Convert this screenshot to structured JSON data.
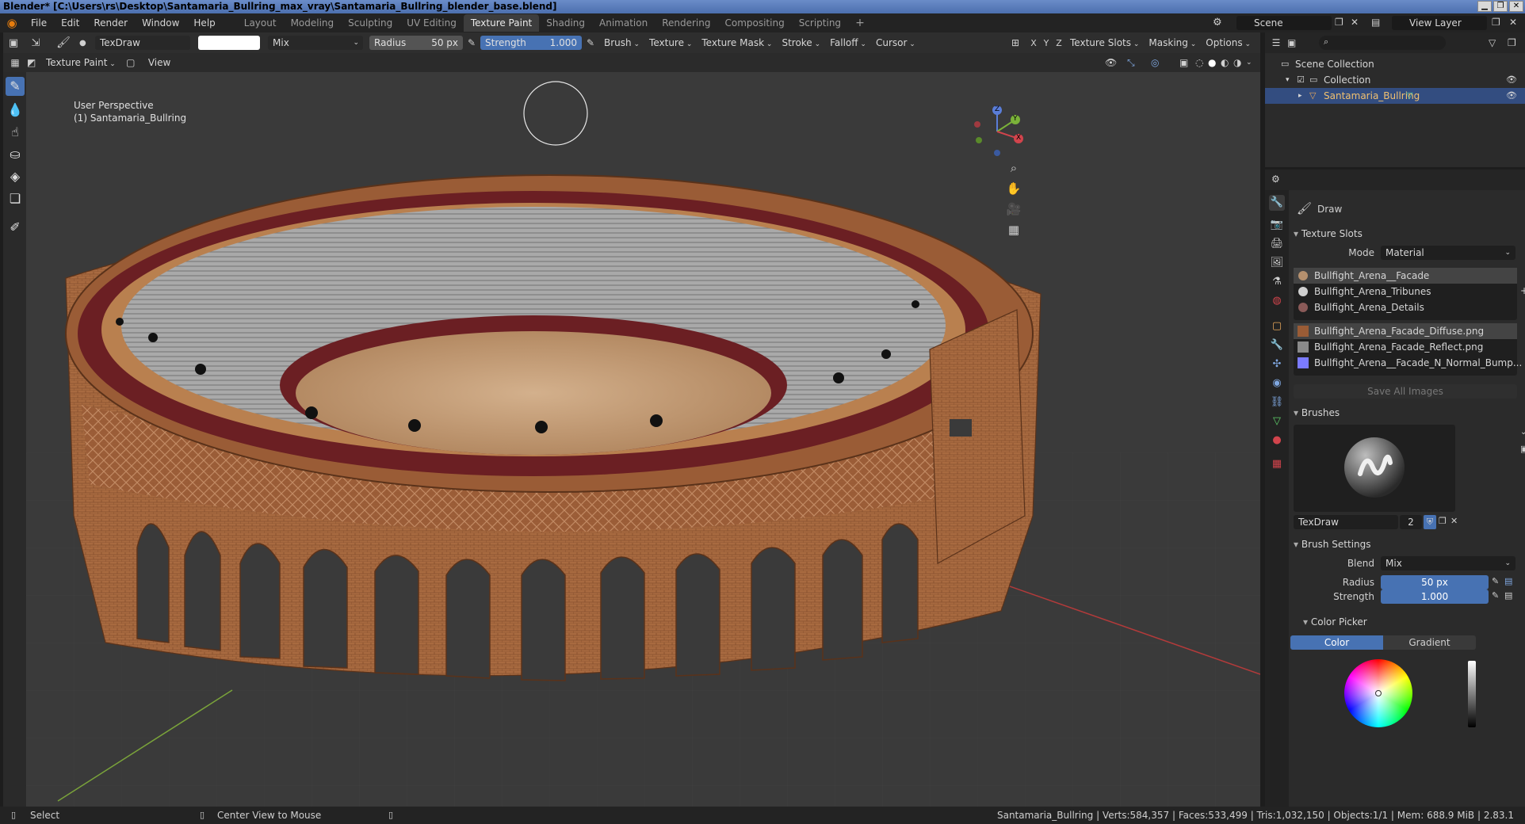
{
  "window": {
    "title": "Blender* [C:\\Users\\rs\\Desktop\\Santamaria_Bullring_max_vray\\Santamaria_Bullring_blender_base.blend]",
    "controls": [
      "▁",
      "❐",
      "✕"
    ]
  },
  "menu": {
    "items": [
      "File",
      "Edit",
      "Render",
      "Window",
      "Help"
    ],
    "workspaces": [
      "Layout",
      "Modeling",
      "Sculpting",
      "UV Editing",
      "Texture Paint",
      "Shading",
      "Animation",
      "Rendering",
      "Compositing",
      "Scripting"
    ],
    "active_workspace": "Texture Paint",
    "add_tab": "+",
    "scene": "Scene",
    "view_layer": "View Layer"
  },
  "tool_header": {
    "brush_name": "TexDraw",
    "blend_mode": "Mix",
    "radius_label": "Radius",
    "radius_value": "50 px",
    "strength_label": "Strength",
    "strength_value": "1.000",
    "menus": [
      "Brush",
      "Texture",
      "Texture Mask",
      "Stroke",
      "Falloff",
      "Cursor"
    ],
    "axes": [
      "X",
      "Y",
      "Z"
    ],
    "right_menus": [
      "Texture Slots",
      "Masking",
      "Options"
    ]
  },
  "view_header": {
    "mode": "Texture Paint",
    "view_menu": "View"
  },
  "viewport": {
    "perspective": "User Perspective",
    "object_label": "(1) Santamaria_Bullring",
    "gizmo_axes": {
      "x": "X",
      "y": "Y",
      "z": "Z"
    }
  },
  "outliner": {
    "scene_collection": "Scene Collection",
    "collection": "Collection",
    "object": "Santamaria_Bullring"
  },
  "properties": {
    "tool_name": "Draw",
    "texture_slots_title": "Texture Slots",
    "mode_label": "Mode",
    "mode_value": "Material",
    "materials": [
      "Bullfight_Arena__Facade",
      "Bullfight_Arena_Tribunes",
      "Bullfight_Arena_Details"
    ],
    "images": [
      "Bullfight_Arena_Facade_Diffuse.png",
      "Bullfight_Arena_Facade_Reflect.png",
      "Bullfight_Arena__Facade_N_Normal_Bump..."
    ],
    "save_all": "Save All Images",
    "brushes_title": "Brushes",
    "brush_name": "TexDraw",
    "brush_users": "2",
    "brush_settings_title": "Brush Settings",
    "blend_label": "Blend",
    "blend_value": "Mix",
    "radius_label": "Radius",
    "radius_value": "50 px",
    "strength_label": "Strength",
    "strength_value": "1.000",
    "color_picker_title": "Color Picker",
    "color_tab": "Color",
    "gradient_tab": "Gradient"
  },
  "statusbar": {
    "select": "Select",
    "center_view": "Center View to Mouse",
    "stats": "Santamaria_Bullring | Verts:584,357 | Faces:533,499 | Tris:1,032,150 | Objects:1/1 | Mem: 688.9 MiB | 2.83.1"
  },
  "colors": {
    "accent": "#4772b3",
    "brush_color": "#ffffff",
    "facade": "#a86a40",
    "inner_wall": "#6b1f23",
    "sand": "#c8a27c",
    "seats": "#a9a9a9"
  }
}
